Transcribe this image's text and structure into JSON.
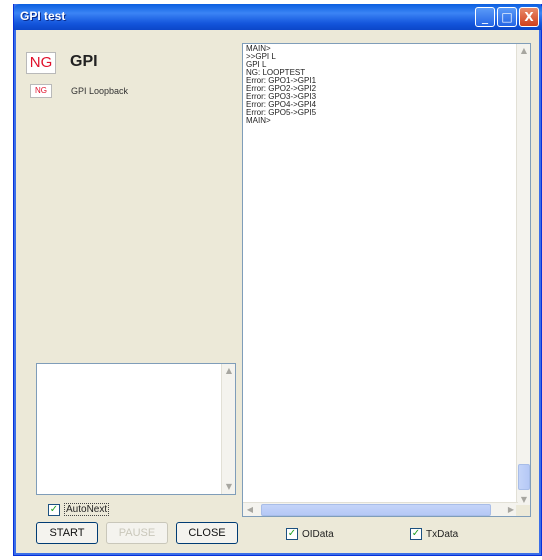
{
  "window": {
    "title": "GPI test"
  },
  "titlebar_buttons": {
    "minimize": "_",
    "maximize": "□",
    "close": "X"
  },
  "test": {
    "status": "NG",
    "name": "GPI",
    "item_status": "NG",
    "item_name": "GPI Loopback"
  },
  "log": {
    "lines": [
      "MAIN>",
      ">>GPI L",
      "GPI L",
      "NG: LOOPTEST",
      "Error: GPO1->GPI1",
      "Error: GPO2->GPI2",
      "Error: GPO3->GPI3",
      "Error: GPO4->GPI4",
      "Error: GPO5->GPI5",
      "MAIN>"
    ]
  },
  "controls": {
    "autonext_label": "AutoNext",
    "autonext_checked": true,
    "start_label": "START",
    "pause_label": "PAUSE",
    "close_label": "CLOSE",
    "oidata_label": "OIData",
    "oidata_checked": true,
    "txdata_label": "TxData",
    "txdata_checked": true
  },
  "icons": {
    "check": "✓",
    "up": "▲",
    "down": "▼",
    "left": "◀",
    "right": "▶"
  },
  "colors": {
    "ng_red": "#e0102a",
    "titlebar_blue": "#1355dc",
    "check_green": "#21a121"
  }
}
